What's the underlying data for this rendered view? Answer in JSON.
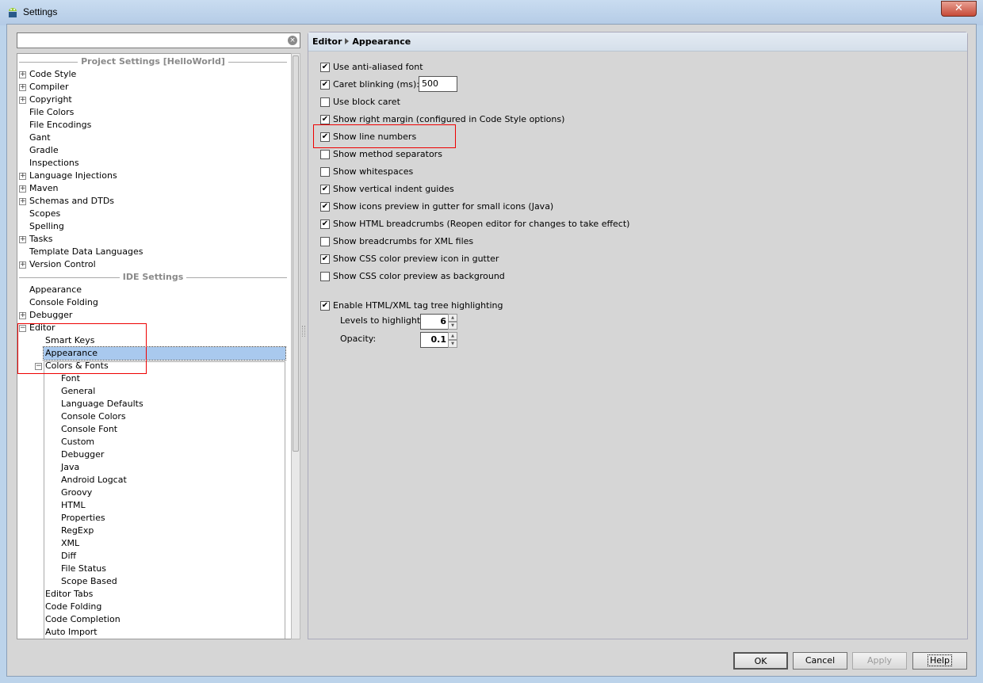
{
  "window": {
    "title": "Settings",
    "close": "✕"
  },
  "search": {
    "value": "",
    "placeholder": ""
  },
  "tree": [
    {
      "type": "header",
      "label": "Project Settings [HelloWorld]"
    },
    {
      "label": "Code Style",
      "level": 0,
      "exp": "+"
    },
    {
      "label": "Compiler",
      "level": 0,
      "exp": "+"
    },
    {
      "label": "Copyright",
      "level": 0,
      "exp": "+"
    },
    {
      "label": "File Colors",
      "level": 0
    },
    {
      "label": "File Encodings",
      "level": 0
    },
    {
      "label": "Gant",
      "level": 0
    },
    {
      "label": "Gradle",
      "level": 0
    },
    {
      "label": "Inspections",
      "level": 0
    },
    {
      "label": "Language Injections",
      "level": 0,
      "exp": "+"
    },
    {
      "label": "Maven",
      "level": 0,
      "exp": "+"
    },
    {
      "label": "Schemas and DTDs",
      "level": 0,
      "exp": "+"
    },
    {
      "label": "Scopes",
      "level": 0
    },
    {
      "label": "Spelling",
      "level": 0
    },
    {
      "label": "Tasks",
      "level": 0,
      "exp": "+"
    },
    {
      "label": "Template Data Languages",
      "level": 0
    },
    {
      "label": "Version Control",
      "level": 0,
      "exp": "+"
    },
    {
      "type": "header",
      "label": "IDE Settings"
    },
    {
      "label": "Appearance",
      "level": 0
    },
    {
      "label": "Console Folding",
      "level": 0
    },
    {
      "label": "Debugger",
      "level": 0,
      "exp": "+"
    },
    {
      "label": "Editor",
      "level": 0,
      "exp": "−"
    },
    {
      "label": "Smart Keys",
      "level": 1
    },
    {
      "label": "Appearance",
      "level": 1,
      "selected": true
    },
    {
      "label": "Colors & Fonts",
      "level": 1,
      "exp": "−"
    },
    {
      "label": "Font",
      "level": 2
    },
    {
      "label": "General",
      "level": 2
    },
    {
      "label": "Language Defaults",
      "level": 2
    },
    {
      "label": "Console Colors",
      "level": 2
    },
    {
      "label": "Console Font",
      "level": 2
    },
    {
      "label": "Custom",
      "level": 2
    },
    {
      "label": "Debugger",
      "level": 2
    },
    {
      "label": "Java",
      "level": 2
    },
    {
      "label": "Android Logcat",
      "level": 2
    },
    {
      "label": "Groovy",
      "level": 2
    },
    {
      "label": "HTML",
      "level": 2
    },
    {
      "label": "Properties",
      "level": 2
    },
    {
      "label": "RegExp",
      "level": 2
    },
    {
      "label": "XML",
      "level": 2
    },
    {
      "label": "Diff",
      "level": 2
    },
    {
      "label": "File Status",
      "level": 2
    },
    {
      "label": "Scope Based",
      "level": 2
    },
    {
      "label": "Editor Tabs",
      "level": 1
    },
    {
      "label": "Code Folding",
      "level": 1
    },
    {
      "label": "Code Completion",
      "level": 1
    },
    {
      "label": "Auto Import",
      "level": 1
    }
  ],
  "panel": {
    "breadcrumb": [
      "Editor",
      "Appearance"
    ],
    "options": [
      {
        "label": "Use anti-aliased font",
        "checked": true
      },
      {
        "label": "Caret blinking (ms):",
        "checked": true
      },
      {
        "label": "Use block caret",
        "checked": false
      },
      {
        "label": "Show right margin (configured in Code Style options)",
        "checked": true
      },
      {
        "label": "Show line numbers",
        "checked": true
      },
      {
        "label": "Show method separators",
        "checked": false
      },
      {
        "label": "Show whitespaces",
        "checked": false
      },
      {
        "label": "Show vertical indent guides",
        "checked": true
      },
      {
        "label": "Show icons preview in gutter for small icons (Java)",
        "checked": true
      },
      {
        "label": "Show HTML breadcrumbs (Reopen editor for changes to take effect)",
        "checked": true
      },
      {
        "label": "Show breadcrumbs for XML files",
        "checked": false
      },
      {
        "label": "Show CSS color preview icon in gutter",
        "checked": true
      },
      {
        "label": "Show CSS color preview as background",
        "checked": false
      },
      {
        "label": "Enable HTML/XML tag tree highlighting",
        "checked": true
      }
    ],
    "caret_blinking_value": "500",
    "levels_label": "Levels to highlight:",
    "levels_value": "6",
    "opacity_label": "Opacity:",
    "opacity_value": "0.1"
  },
  "buttons": {
    "ok": "OK",
    "cancel": "Cancel",
    "apply": "Apply",
    "help": "Help"
  },
  "colors": {
    "selection": "#a9c9ee",
    "highlight_box": "#ee0000",
    "panel_header": "#dfe6ee"
  }
}
